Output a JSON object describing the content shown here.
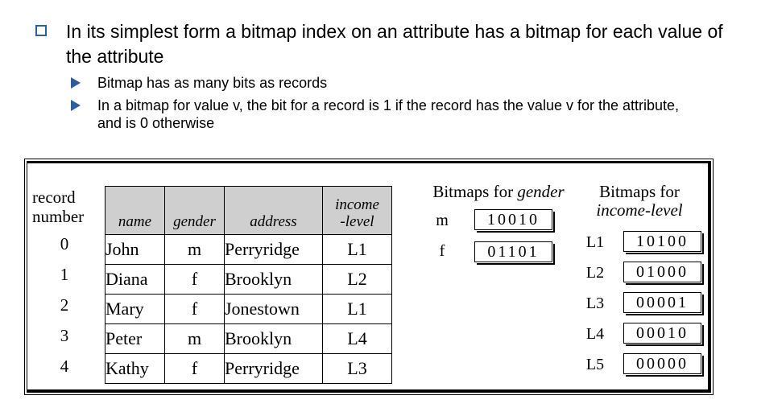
{
  "intro": {
    "main": "In its simplest form a bitmap index on an attribute has a bitmap for each value of the attribute",
    "subs": [
      "Bitmap has as many bits as records",
      "In a bitmap for value v, the bit for a record is 1 if the record has the value v for the attribute, and is 0 otherwise"
    ]
  },
  "figure": {
    "record_header_1": "record",
    "record_header_2": "number",
    "columns": [
      "name",
      "gender",
      "address",
      "income",
      "-level"
    ],
    "records": [
      {
        "num": "0",
        "name": "John",
        "gender": "m",
        "address": "Perryridge",
        "income": "L1"
      },
      {
        "num": "1",
        "name": "Diana",
        "gender": "f",
        "address": "Brooklyn",
        "income": "L2"
      },
      {
        "num": "2",
        "name": "Mary",
        "gender": "f",
        "address": "Jonestown",
        "income": "L1"
      },
      {
        "num": "3",
        "name": "Peter",
        "gender": "m",
        "address": "Brooklyn",
        "income": "L4"
      },
      {
        "num": "4",
        "name": "Kathy",
        "gender": "f",
        "address": "Perryridge",
        "income": "L3"
      }
    ],
    "gender_bitmaps": {
      "title_prefix": "Bitmaps for ",
      "title_italic": "gender",
      "items": [
        {
          "label": "m",
          "bits": "10010"
        },
        {
          "label": "f",
          "bits": "01101"
        }
      ]
    },
    "income_bitmaps": {
      "title_line1": "Bitmaps for",
      "title_line2": "income-level",
      "items": [
        {
          "label": "L1",
          "bits": "10100"
        },
        {
          "label": "L2",
          "bits": "01000"
        },
        {
          "label": "L3",
          "bits": "00001"
        },
        {
          "label": "L4",
          "bits": "00010"
        },
        {
          "label": "L5",
          "bits": "00000"
        }
      ]
    }
  }
}
